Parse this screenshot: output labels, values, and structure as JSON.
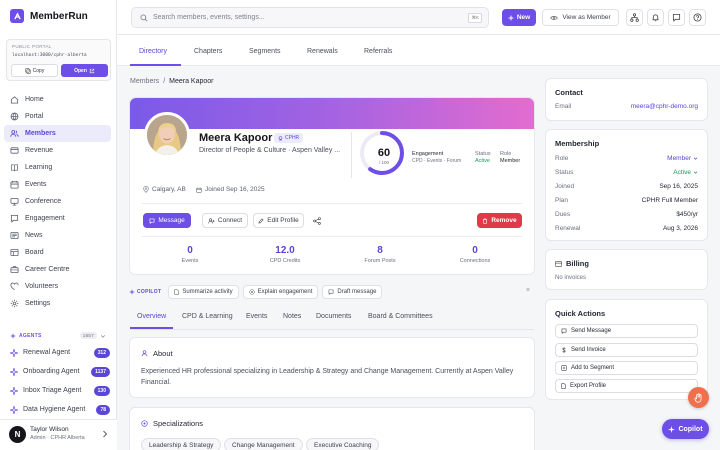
{
  "app": {
    "name": "MemberRun"
  },
  "portal": {
    "title": "PUBLIC PORTAL",
    "url": "localhost:3000/cphr-alberta",
    "copy_label": "Copy",
    "open_label": "Open"
  },
  "nav": [
    {
      "label": "Home",
      "icon": "home-icon"
    },
    {
      "label": "Portal",
      "icon": "globe-icon"
    },
    {
      "label": "Members",
      "icon": "users-icon",
      "active": true
    },
    {
      "label": "Revenue",
      "icon": "revenue-icon"
    },
    {
      "label": "Learning",
      "icon": "book-icon"
    },
    {
      "label": "Events",
      "icon": "calendar-icon"
    },
    {
      "label": "Conference",
      "icon": "conference-icon"
    },
    {
      "label": "Engagement",
      "icon": "engagement-icon"
    },
    {
      "label": "News",
      "icon": "news-icon"
    },
    {
      "label": "Board",
      "icon": "board-icon"
    },
    {
      "label": "Career Centre",
      "icon": "briefcase-icon"
    },
    {
      "label": "Volunteers",
      "icon": "heart-icon"
    },
    {
      "label": "Settings",
      "icon": "gear-icon"
    }
  ],
  "agents": {
    "header": "AGENTS",
    "count": "1657",
    "items": [
      {
        "label": "Renewal Agent",
        "badge": "312"
      },
      {
        "label": "Onboarding Agent",
        "badge": "1137"
      },
      {
        "label": "Inbox Triage Agent",
        "badge": "130"
      },
      {
        "label": "Data Hygiene Agent",
        "badge": "78"
      }
    ]
  },
  "user": {
    "initial": "N",
    "name": "Taylor Wilson",
    "role": "Admin · CPHR Alberta"
  },
  "topbar": {
    "search_placeholder": "Search members, events, settings...",
    "shortcut": "⌘K",
    "new_label": "New",
    "view_label": "View as Member"
  },
  "main_tabs": [
    "Directory",
    "Chapters",
    "Segments",
    "Renewals",
    "Referrals"
  ],
  "breadcrumb": {
    "parent": "Members",
    "sep": "/",
    "current": "Meera Kapoor"
  },
  "profile": {
    "name": "Meera Kapoor",
    "badge": "CPHR",
    "title": "Director of People & Culture · Aspen Valley ...",
    "score": "60",
    "score_max": "/ 100",
    "score_fraction": 0.6,
    "engagement_label": "Engagement",
    "engagement_sub": "CPD · Events · Forum",
    "status_label": "Status",
    "status_value": "Active",
    "role_label": "Role",
    "role_value": "Member",
    "location": "Calgary, AB",
    "joined": "Joined Sep 16, 2025",
    "actions": {
      "message": "Message",
      "connect": "Connect",
      "edit": "Edit Profile",
      "remove": "Remove"
    },
    "stats": [
      {
        "value": "0",
        "label": "Events"
      },
      {
        "value": "12.0",
        "label": "CPD Credits"
      },
      {
        "value": "8",
        "label": "Forum Posts"
      },
      {
        "value": "0",
        "label": "Connections"
      }
    ]
  },
  "copilot": {
    "label": "COPILOT",
    "chips": [
      "Summarize activity",
      "Explain engagement",
      "Draft message"
    ],
    "close": "×"
  },
  "sub_tabs": [
    "Overview",
    "CPD & Learning",
    "Events",
    "Notes",
    "Documents",
    "Board & Committees"
  ],
  "about": {
    "title": "About",
    "text": "Experienced HR professional specializing in Leadership & Strategy and Change Management. Currently at Aspen Valley Financial."
  },
  "specializations": {
    "title": "Specializations",
    "tags": [
      "Leadership & Strategy",
      "Change Management",
      "Executive Coaching"
    ]
  },
  "contact": {
    "title": "Contact",
    "email_label": "Email",
    "email": "meera@cphr-demo.org"
  },
  "membership": {
    "title": "Membership",
    "rows": [
      {
        "k": "Role",
        "v": "Member"
      },
      {
        "k": "Status",
        "v": "Active"
      },
      {
        "k": "Joined",
        "v": "Sep 16, 2025"
      },
      {
        "k": "Plan",
        "v": "CPHR Full Member"
      },
      {
        "k": "Dues",
        "v": "$450/yr"
      },
      {
        "k": "Renewal",
        "v": "Aug 3, 2026"
      }
    ]
  },
  "billing": {
    "title": "Billing",
    "text": "No invoices"
  },
  "quick_actions": {
    "title": "Quick Actions",
    "items": [
      "Send Message",
      "Send Invoice",
      "Add to Segment",
      "Export Profile"
    ]
  },
  "fab": {
    "copilot_label": "Copilot"
  },
  "colors": {
    "accent": "#6d4ee6",
    "danger": "#e03a4a",
    "success": "#1e9a58"
  }
}
